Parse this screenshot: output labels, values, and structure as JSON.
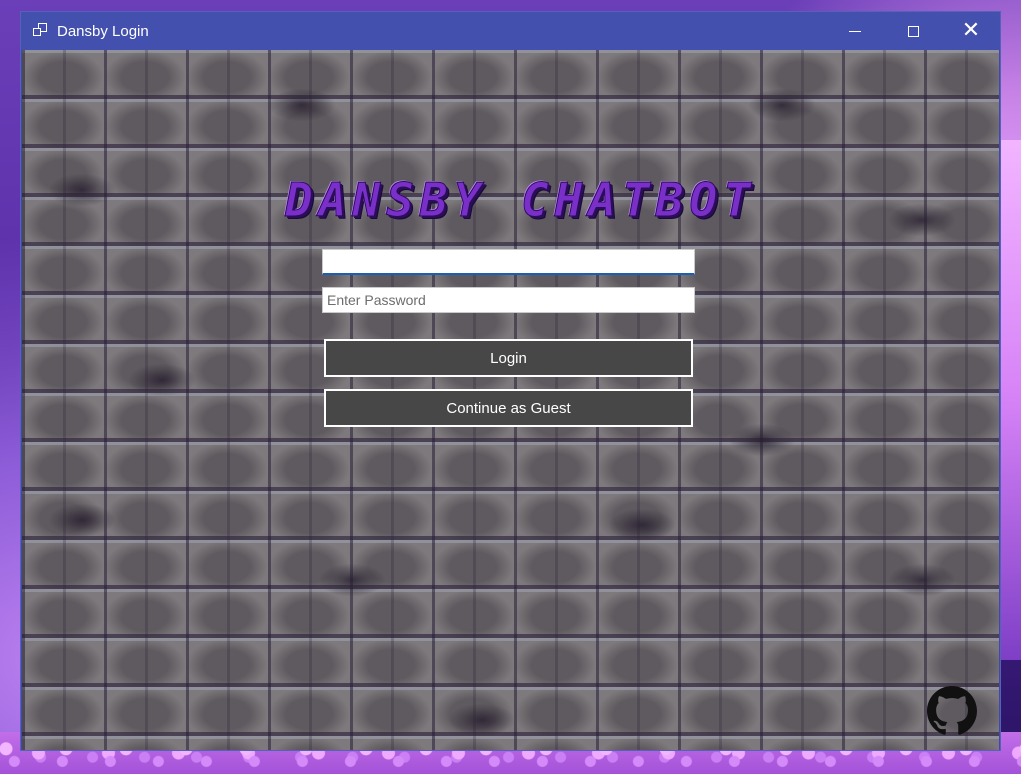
{
  "window": {
    "title": "Dansby Login",
    "controls": {
      "minimize_icon": "minimize-icon",
      "maximize_icon": "maximize-icon",
      "close_icon": "close-icon"
    }
  },
  "main": {
    "logo_text": "DANSBY CHATBOT",
    "username": {
      "value": "",
      "placeholder": ""
    },
    "password": {
      "value": "",
      "placeholder": "Enter Password"
    },
    "login_label": "Login",
    "guest_label": "Continue as Guest",
    "github_icon": "github-icon"
  },
  "colors": {
    "titlebar": "#4350ad",
    "button_bg": "#474747",
    "logo_purple": "#7a2fc8",
    "focus_underline": "#1a5fb4"
  }
}
